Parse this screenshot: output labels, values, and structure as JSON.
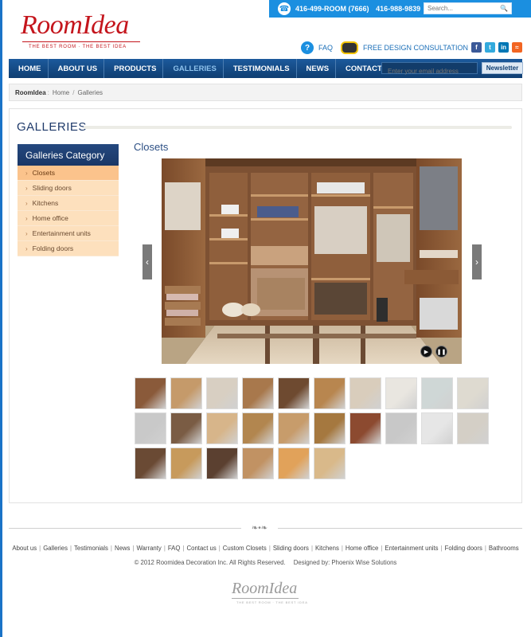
{
  "top_bar": {
    "phone_primary": "416-499-ROOM (7666)",
    "phone_secondary": "416-988-9839",
    "search_placeholder": "Search..."
  },
  "logo": {
    "name": "RoomIdea",
    "tagline": "THE BEST ROOM · THE BEST IDEA"
  },
  "utility": {
    "faq": "FAQ",
    "design": "FREE DESIGN CONSULTATION"
  },
  "socials": [
    "facebook-icon",
    "twitter-icon",
    "linkedin-icon",
    "rss-icon"
  ],
  "nav": {
    "items": [
      "HOME",
      "ABOUT US",
      "PRODUCTS",
      "GALLERIES",
      "TESTIMONIALS",
      "NEWS",
      "CONTACT US"
    ],
    "active": "GALLERIES",
    "email_placeholder": "Enter your email address",
    "newsletter": "Newsletter"
  },
  "breadcrumb": {
    "site": "RoomIdea",
    "sep1": ":",
    "home": "Home",
    "sep2": "/",
    "current": "Galleries"
  },
  "page": {
    "title": "GALLERIES",
    "category_heading": "Galleries Category",
    "categories": [
      "Closets",
      "Sliding doors",
      "Kitchens",
      "Home office",
      "Entertainment units",
      "Folding doors"
    ],
    "active_category": "Closets",
    "gallery_title": "Closets",
    "thumbnail_count": 26
  },
  "footer": {
    "links": [
      "About us",
      "Galleries",
      "Testimonials",
      "News",
      "Warranty",
      "FAQ",
      "Contact us",
      "Custom Closets",
      "Sliding doors",
      "Kitchens",
      "Home office",
      "Entertainment units",
      "Folding doors",
      "Bathrooms"
    ],
    "copyright": "© 2012 Roomidea Decoration Inc. All Rights Reserved.",
    "designed_by": "Designed by: Phoenix Wise Solutions",
    "logo": "RoomIdea",
    "logo_tagline": "THE BEST ROOM · THE BEST IDEA"
  },
  "colors": {
    "nav_blue": "#0f3e72",
    "top_bar": "#1b8fe0",
    "category_active": "#fbc38c",
    "category_item": "#fde0bd",
    "brand_red": "#c4151c"
  }
}
